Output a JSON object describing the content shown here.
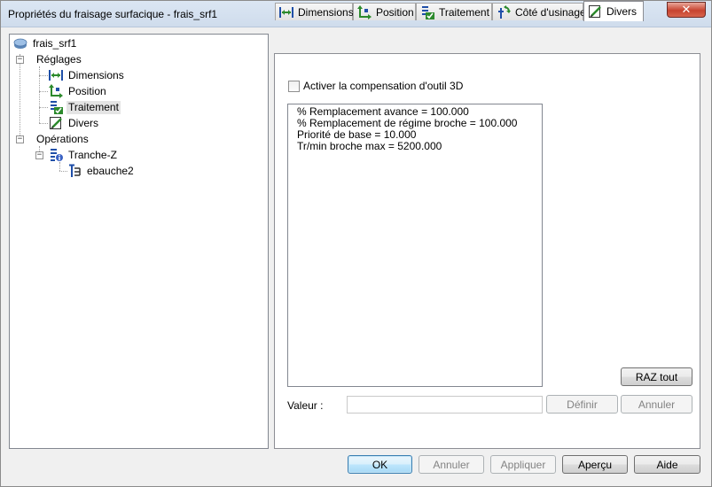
{
  "window": {
    "title": "Propriétés du fraisage surfacique - frais_srf1"
  },
  "tree": {
    "root": "frais_srf1",
    "settings": "Réglages",
    "settings_items": [
      "Dimensions",
      "Position",
      "Traitement",
      "Divers"
    ],
    "operations": "Opérations",
    "operation": "Tranche-Z",
    "sub_operation": "ebauche2"
  },
  "tabs": [
    {
      "label": "Dimensions",
      "icon": "dimensions-icon"
    },
    {
      "label": "Position",
      "icon": "position-icon"
    },
    {
      "label": "Traitement",
      "icon": "treatment-icon"
    },
    {
      "label": "Côté d'usinage",
      "icon": "machining-side-icon"
    },
    {
      "label": "Divers",
      "icon": "misc-icon"
    }
  ],
  "divers": {
    "checkbox_label": "Activer la compensation d'outil 3D",
    "checkbox_checked": false,
    "list_lines": [
      "% Remplacement avance = 100.000",
      "% Remplacement de régime broche = 100.000",
      "Priorité de base = 10.000",
      "Tr/min broche max = 5200.000"
    ],
    "reset_all": "RAZ tout",
    "value_label": "Valeur :",
    "value": "",
    "define": "Définir",
    "cancel": "Annuler"
  },
  "footer": {
    "ok": "OK",
    "cancel": "Annuler",
    "apply": "Appliquer",
    "preview": "Aperçu",
    "help": "Aide"
  },
  "colors": {
    "titlebar": "#cfdcec",
    "close_button": "#c7432f",
    "default_button": "#a7d9f5",
    "icon_green": "#2c8a2c",
    "icon_blue": "#1f4fa8"
  }
}
